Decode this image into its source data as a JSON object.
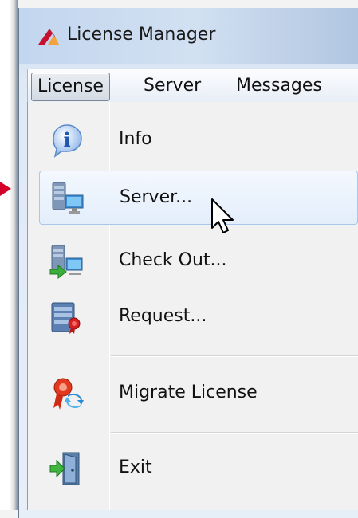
{
  "window": {
    "title": "License Manager"
  },
  "menubar": {
    "items": [
      "License",
      "Server",
      "Messages"
    ]
  },
  "dropdown": {
    "items": [
      {
        "label": "Info",
        "icon": "info-icon"
      },
      {
        "label": "Server...",
        "icon": "server-icon"
      },
      {
        "label": "Check Out...",
        "icon": "check-out-icon"
      },
      {
        "label": "Request...",
        "icon": "request-icon"
      },
      {
        "label": "Migrate License",
        "icon": "migrate-license-icon"
      },
      {
        "label": "Exit",
        "icon": "exit-icon"
      }
    ]
  },
  "colors": {
    "highlight_border": "#a9c7ec",
    "arrow": "#d4002a"
  }
}
